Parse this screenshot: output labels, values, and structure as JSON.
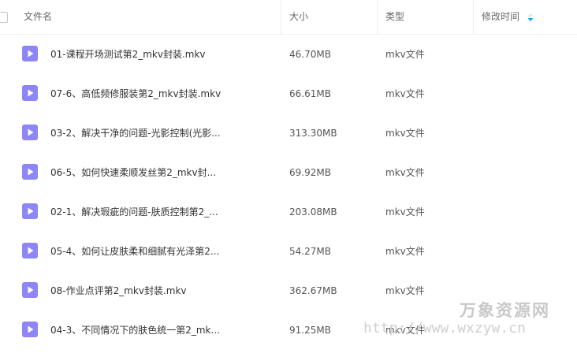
{
  "header": {
    "name_label": "文件名",
    "size_label": "大小",
    "type_label": "类型",
    "modified_label": "修改时间"
  },
  "files": [
    {
      "name": "01-课程开场测试第2_mkv封装.mkv",
      "size": "46.70MB",
      "type": "mkv文件"
    },
    {
      "name": "07-6、高低频修服装第2_mkv封装.mkv",
      "size": "66.61MB",
      "type": "mkv文件"
    },
    {
      "name": "03-2、解决干净的问题-光影控制(光影...",
      "size": "313.30MB",
      "type": "mkv文件"
    },
    {
      "name": "06-5、如何快速柔顺发丝第2_mkv封...",
      "size": "69.92MB",
      "type": "mkv文件"
    },
    {
      "name": "02-1、解决瑕疵的问题-肤质控制第2_...",
      "size": "203.08MB",
      "type": "mkv文件"
    },
    {
      "name": "05-4、如何让皮肤柔和细腻有光泽第2...",
      "size": "54.27MB",
      "type": "mkv文件"
    },
    {
      "name": "08-作业点评第2_mkv封装.mkv",
      "size": "362.67MB",
      "type": "mkv文件"
    },
    {
      "name": "04-3、不同情况下的肤色统一第2_mk...",
      "size": "91.25MB",
      "type": "mkv文件"
    }
  ],
  "watermark": {
    "title": "万象资源网",
    "url": "http://www.wxzyw.cn"
  },
  "icons": {
    "file": "video-file-icon",
    "sort": "sort-icon"
  },
  "colors": {
    "file_icon": "#8e85f6",
    "sort_icon": "#06a7ff"
  }
}
